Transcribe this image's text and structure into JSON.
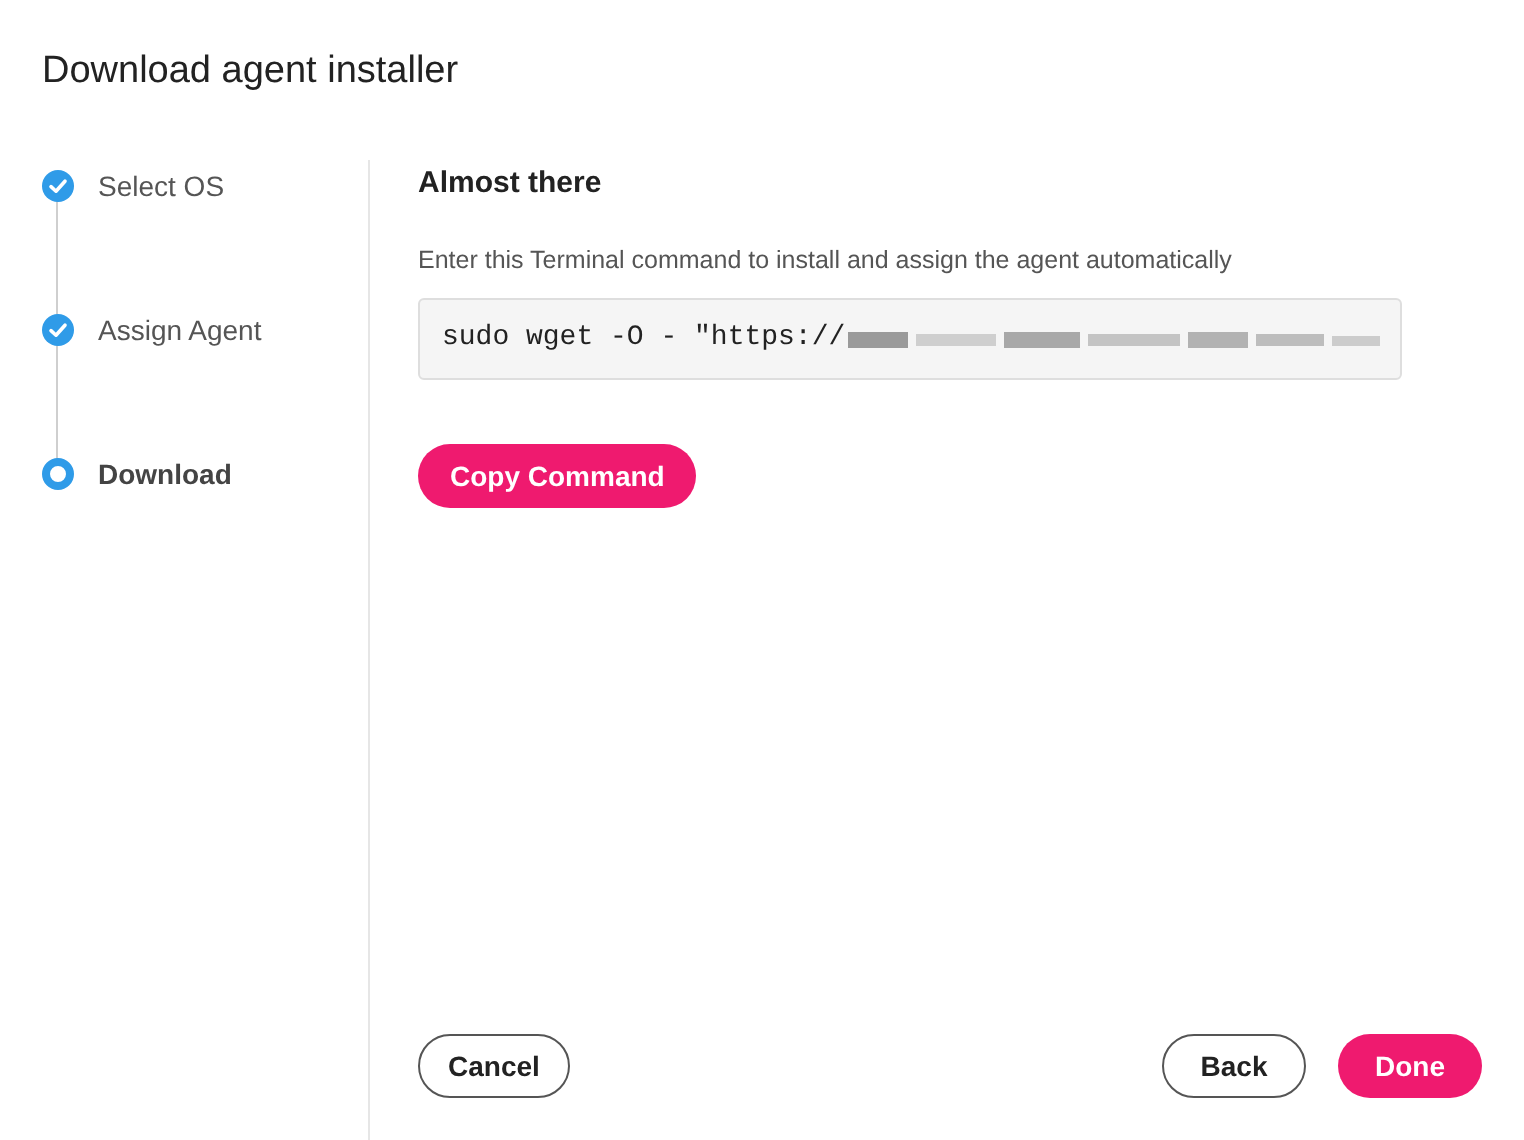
{
  "dialog": {
    "title": "Download agent installer"
  },
  "steps": [
    {
      "label": "Select OS",
      "completed": true,
      "selected": false
    },
    {
      "label": "Assign Agent",
      "completed": true,
      "selected": false
    },
    {
      "label": "Download",
      "completed": false,
      "selected": true
    }
  ],
  "content": {
    "heading": "Almost there",
    "description": "Enter this Terminal command to install and assign the agent automatically",
    "command": "sudo wget -O - \"https://",
    "copy_button": "Copy Command"
  },
  "footer": {
    "cancel": "Cancel",
    "back": "Back",
    "done": "Done"
  }
}
